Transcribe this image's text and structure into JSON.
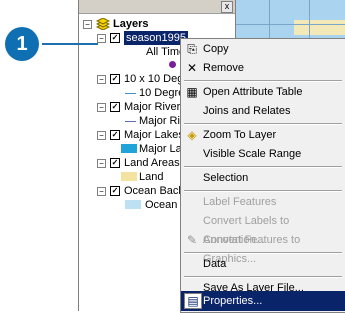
{
  "callout": {
    "number": "1"
  },
  "toc": {
    "close_glyph": "x",
    "root": {
      "label": "Layers",
      "icon": "layers-icon"
    },
    "layers": [
      {
        "label": "season1995",
        "sublabel": "All Time",
        "symbol_color": "#7a1f9c"
      },
      {
        "label": "10 x 10 Degr",
        "sublabel": "10 Degree",
        "symbol_color": "#4a90c8"
      },
      {
        "label": "Major Rivers",
        "sublabel": "Major Riv",
        "symbol_color": "#5a6fb0"
      },
      {
        "label": "Major Lakes",
        "sublabel": "Major Lak",
        "symbol_color": "#1fa3d8"
      },
      {
        "label": "Land Areas",
        "sublabel": "Land",
        "symbol_color": "#f3e2a0"
      },
      {
        "label": "Ocean Backgr",
        "sublabel": "Ocean",
        "symbol_color": "#bde0f2"
      }
    ]
  },
  "menu": {
    "items": [
      {
        "label": "Copy",
        "icon": "copy-icon",
        "enabled": true
      },
      {
        "label": "Remove",
        "icon": "remove-icon",
        "enabled": true
      },
      {
        "label": "Open Attribute Table",
        "icon": "table-icon",
        "enabled": true
      },
      {
        "label": "Joins and Relates",
        "icon": "",
        "enabled": true
      },
      {
        "label": "Zoom To Layer",
        "icon": "zoom-to-layer-icon",
        "enabled": true
      },
      {
        "label": "Visible Scale Range",
        "icon": "",
        "enabled": true
      },
      {
        "label": "Selection",
        "icon": "",
        "enabled": true
      },
      {
        "label": "Label Features",
        "icon": "",
        "enabled": false
      },
      {
        "label": "Convert Labels to Annotation...",
        "icon": "",
        "enabled": false
      },
      {
        "label": "Convert Features to Graphics...",
        "icon": "convert-graphics-icon",
        "enabled": false
      },
      {
        "label": "Data",
        "icon": "",
        "enabled": true
      },
      {
        "label": "Save As Layer File...",
        "icon": "",
        "enabled": true
      },
      {
        "label": "Properties...",
        "icon": "properties-icon",
        "enabled": true,
        "highlighted": true
      }
    ]
  }
}
